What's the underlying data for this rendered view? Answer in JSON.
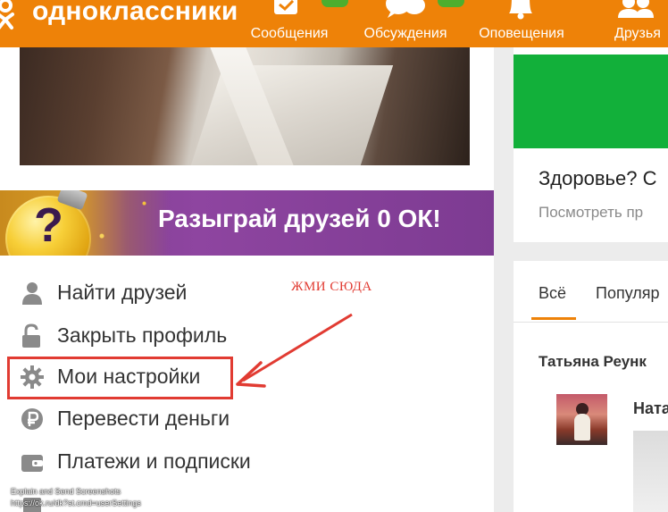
{
  "header": {
    "logo_text": "одноклассники",
    "nav": [
      {
        "label": "Сообщения",
        "icon": "envelope-icon"
      },
      {
        "label": "Обсуждения",
        "icon": "chat-bubbles-icon"
      },
      {
        "label": "Оповещения",
        "icon": "bell-icon"
      },
      {
        "label": "Друзья",
        "icon": "friends-icon"
      }
    ]
  },
  "promo": {
    "text": "Разыграй друзей 0 ОК!"
  },
  "menu": [
    {
      "label": "Найти друзей",
      "icon": "person-icon"
    },
    {
      "label": "Закрыть профиль",
      "icon": "unlocked-padlock-icon"
    },
    {
      "label": "Мои настройки",
      "icon": "gear-icon"
    },
    {
      "label": "Перевести деньги",
      "icon": "ruble-icon"
    },
    {
      "label": "Платежи и подписки",
      "icon": "wallet-icon"
    }
  ],
  "annotation": {
    "text": "ЖМИ СЮДА",
    "color": "#e13b32"
  },
  "footer": {
    "line1": "Explain and Send Screenshots",
    "line2": "https://ok.ru/dk?st.cmd=userSettings"
  },
  "right_card": {
    "title": "Здоровье? С",
    "subtitle": "Посмотреть пр"
  },
  "feed": {
    "tabs": [
      "Всё",
      "Популяр"
    ],
    "author": "Татьяна Реунк",
    "name": "Ната"
  },
  "colors": {
    "brand_orange": "#ee8208",
    "badge_green": "#4dae2e",
    "card_green": "#12b03a"
  }
}
